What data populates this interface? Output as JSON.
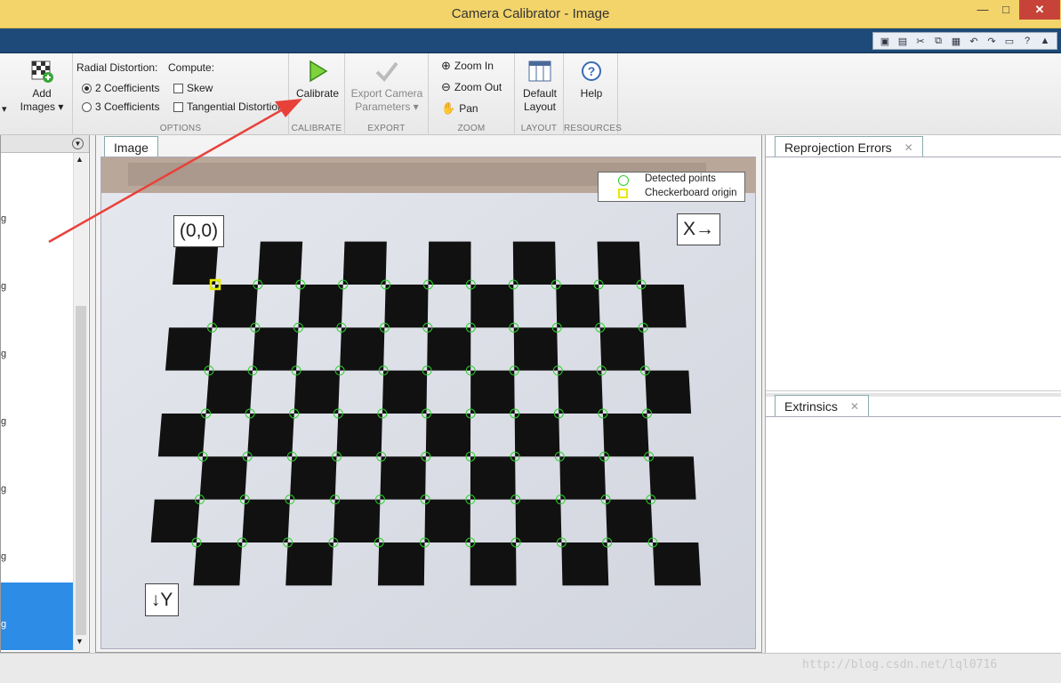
{
  "window": {
    "title": "Camera Calibrator - Image",
    "minimize": "—",
    "maximize": "□",
    "close": "✕"
  },
  "ribbon": {
    "add_images": {
      "line1": "Add",
      "line2": "Images ▾",
      "left_caret": "▾"
    },
    "options": {
      "radial_label": "Radial Distortion:",
      "compute_label": "Compute:",
      "coef2": "2 Coefficients",
      "coef3": "3 Coefficients",
      "skew": "Skew",
      "tangential": "Tangential Distortion",
      "group": "OPTIONS"
    },
    "calibrate": {
      "label": "Calibrate",
      "group": "CALIBRATE"
    },
    "export": {
      "line1": "Export Camera",
      "line2": "Parameters ▾",
      "group": "EXPORT"
    },
    "zoom": {
      "zoom_in": "Zoom In",
      "zoom_out": "Zoom Out",
      "pan": "Pan",
      "group": "ZOOM"
    },
    "layout": {
      "line1": "Default",
      "line2": "Layout",
      "group": "LAYOUT"
    },
    "help": {
      "label": "Help",
      "group": "RESOURCES"
    }
  },
  "browser": {
    "items": [
      "g",
      "g",
      "g",
      "g",
      "g",
      "g",
      "g"
    ]
  },
  "image_panel": {
    "tab": "Image",
    "legend": {
      "detected": "Detected points",
      "origin": "Checkerboard origin"
    },
    "origin_label": "(0,0)",
    "x_label": "X→",
    "y_label": "↓Y"
  },
  "right_panels": {
    "reprojection": "Reprojection Errors",
    "extrinsics": "Extrinsics"
  },
  "watermark": "http://blog.csdn.net/lql0716",
  "colors": {
    "title": "#f3d46b",
    "tabstrip": "#1d4a78",
    "selection": "#2d8ce6",
    "detected": "#2cd12c",
    "origin": "#e8e800",
    "arrow": "#e8413a"
  }
}
